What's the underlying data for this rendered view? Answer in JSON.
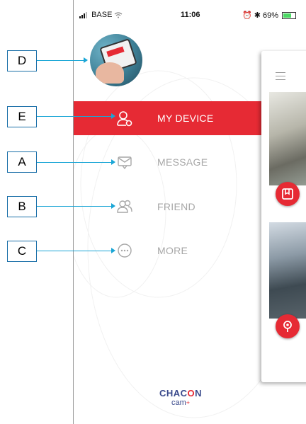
{
  "status_bar": {
    "carrier": "BASE",
    "time": "11:06",
    "battery": "69%",
    "battery_fraction": 0.69
  },
  "menu": {
    "items": [
      {
        "label": "MY DEVICE",
        "icon": "device-user-icon",
        "active": true
      },
      {
        "label": "MESSAGE",
        "icon": "message-icon",
        "active": false
      },
      {
        "label": "FRIEND",
        "icon": "friends-icon",
        "active": false
      },
      {
        "label": "MORE",
        "icon": "more-icon",
        "active": false
      }
    ]
  },
  "logo": {
    "brand_prefix": "CHAC",
    "brand_o": "O",
    "brand_suffix": "N",
    "sub": "cam",
    "sub_mark": "+"
  },
  "callouts": {
    "d": "D",
    "e": "E",
    "a": "A",
    "b": "B",
    "c": "C"
  },
  "colors": {
    "accent": "#e62a34",
    "callout_line": "#1aa6d6",
    "callout_border": "#1a6fa8",
    "menu_text": "#a7a7a7",
    "brand_blue": "#3a4a8c"
  }
}
